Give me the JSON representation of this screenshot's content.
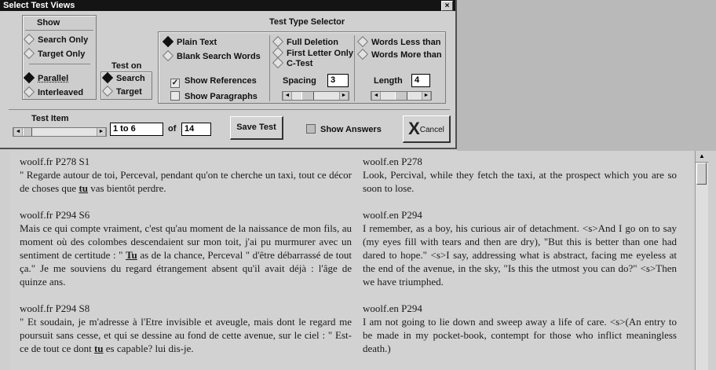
{
  "window": {
    "title": "Select Test Views",
    "close_glyph": "×"
  },
  "show": {
    "header": "Show",
    "search_only": "Search Only",
    "target_only": "Target Only",
    "parallel": "Parallel",
    "interleaved": "Interleaved"
  },
  "test_on": {
    "header": "Test on",
    "search": "Search",
    "target": "Target"
  },
  "test_type": {
    "header": "Test Type Selector",
    "plain_text": "Plain Text",
    "blank_search_words": "Blank Search Words",
    "full_deletion": "Full Deletion",
    "first_letter_only": "First Letter Only",
    "c_test": "C-Test",
    "words_less_than": "Words Less than",
    "words_more_than": "Words More than",
    "show_references": "Show References",
    "show_paragraphs": "Show Paragraphs",
    "spacing_label": "Spacing",
    "spacing_value": "3",
    "length_label": "Length",
    "length_value": "4"
  },
  "test_item": {
    "header": "Test Item",
    "range": "1 to 6",
    "of_label": "of",
    "total": "14"
  },
  "buttons": {
    "save_test": "Save Test",
    "show_answers": "Show Answers",
    "cancel": "Cancel",
    "cancel_glyph": "X"
  },
  "scroll_glyphs": {
    "left": "◄",
    "right": "►",
    "up": "▲"
  },
  "entries": {
    "left": [
      {
        "ref": "woolf.fr  P278  S1",
        "pre": "\" Regarde autour de toi, Perceval, pendant qu'on te cherche un taxi, tout ce décor de choses que ",
        "hl": "tu",
        "post": " vas bientôt perdre."
      },
      {
        "ref": "woolf.fr  P294  S6",
        "pre": "Mais ce qui compte vraiment, c'est qu'au moment de la naissance de mon fils, au moment où des colombes descendaient sur mon toit, j'ai pu murmurer avec un sentiment de certitude : \" ",
        "hl": "Tu",
        "post": " as de la chance, Perceval \" d'être débarrassé de tout ça.\" Je me souviens du regard étrangement absent qu'il avait déjà : l'âge de quinze ans."
      },
      {
        "ref": "woolf.fr  P294  S8",
        "pre": "\" Et soudain, je m'adresse à l'Etre invisible et aveugle, mais dont le regard me poursuit sans cesse, et qui se dessine au fond de cette avenue, sur le ciel : \" Est-ce de tout ce dont ",
        "hl": "tu",
        "post": " es capable? lui dis-je."
      }
    ],
    "right": [
      {
        "ref": "woolf.en  P278",
        "text": "Look, Percival, while they fetch the taxi, at the prospect which you are so soon to lose."
      },
      {
        "ref": "woolf.en  P294",
        "text": "I remember, as a boy, his curious air of detachment. <s>And I go on to say (my eyes fill with tears and then are dry), \"But this is better than one had dared to hope.\" <s>I say, addressing what is abstract, facing me eyeless at the end of the avenue, in the sky, \"Is this the utmost you can do?\" <s>Then we have triumphed."
      },
      {
        "ref": "woolf.en  P294",
        "text": "I am not going to lie down and sweep away a life of care. <s>(An entry to be made in my pocket-book, contempt for those who inflict meaningless death.)"
      }
    ]
  }
}
